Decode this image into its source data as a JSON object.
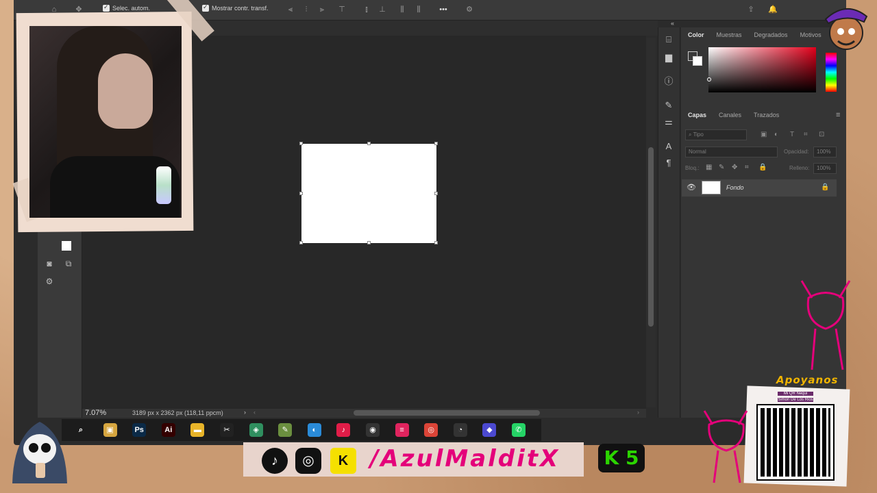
{
  "window": {
    "app": "Photoshop"
  },
  "options_bar": {
    "auto_select_label": "Selec. autom.",
    "show_transform_label": "Mostrar contr. transf.",
    "more_label": "•••"
  },
  "status_bar": {
    "zoom": "7.07%",
    "doc_info": "3189 px x 2362 px (118,11 ppcm)"
  },
  "color_panel": {
    "tabs": [
      "Color",
      "Muestras",
      "Degradados",
      "Motivos"
    ],
    "active_tab": "Color"
  },
  "layers_panel": {
    "tabs": [
      "Capas",
      "Canales",
      "Trazados"
    ],
    "active_tab": "Capas",
    "search_placeholder": "Tipo",
    "blend_mode": "Normal",
    "opacity_label": "Opacidad:",
    "opacity_value": "100%",
    "lock_label": "Bloq.:",
    "fill_label": "Relleno:",
    "fill_value": "100%",
    "layers": [
      {
        "name": "Fondo",
        "visible": true,
        "locked": true
      }
    ]
  },
  "taskbar": {
    "apps": [
      {
        "name": "search",
        "label": "⌕",
        "color": "#1c1c1c"
      },
      {
        "name": "file-explorer-old",
        "label": "▣",
        "color": "#d6a640"
      },
      {
        "name": "photoshop",
        "label": "Ps",
        "color": "#0b2a47"
      },
      {
        "name": "illustrator",
        "label": "Ai",
        "color": "#330000"
      },
      {
        "name": "file-explorer",
        "label": "▬",
        "color": "#e8b429"
      },
      {
        "name": "capcut",
        "label": "✂",
        "color": "#222"
      },
      {
        "name": "clipchamp",
        "label": "◈",
        "color": "#2f8f5f"
      },
      {
        "name": "paint",
        "label": "✎",
        "color": "#6b8f3f"
      },
      {
        "name": "app-blue",
        "label": "◐",
        "color": "#2a8bd8"
      },
      {
        "name": "tiktok",
        "label": "♪",
        "color": "#e11d48"
      },
      {
        "name": "obs",
        "label": "◉",
        "color": "#333"
      },
      {
        "name": "streaming-app",
        "label": "≡",
        "color": "#e0245e"
      },
      {
        "name": "chrome",
        "label": "◎",
        "color": "#db4437"
      },
      {
        "name": "recorder",
        "label": "◔",
        "color": "#333"
      },
      {
        "name": "app-purple",
        "label": "◆",
        "color": "#4b49d0"
      },
      {
        "name": "whatsapp",
        "label": "✆",
        "color": "#25d366"
      }
    ]
  },
  "overlay": {
    "handle": "/AzulMalditX",
    "k5_label": "K 5",
    "support_title": "Apoyanos",
    "qr_line1": "Mi QR Nequi",
    "qr_line2": "Simon De Los Rios"
  },
  "colors": {
    "accent_magenta": "#e4007a",
    "k5_green": "#2bd400",
    "support_gold": "#f0b400"
  }
}
